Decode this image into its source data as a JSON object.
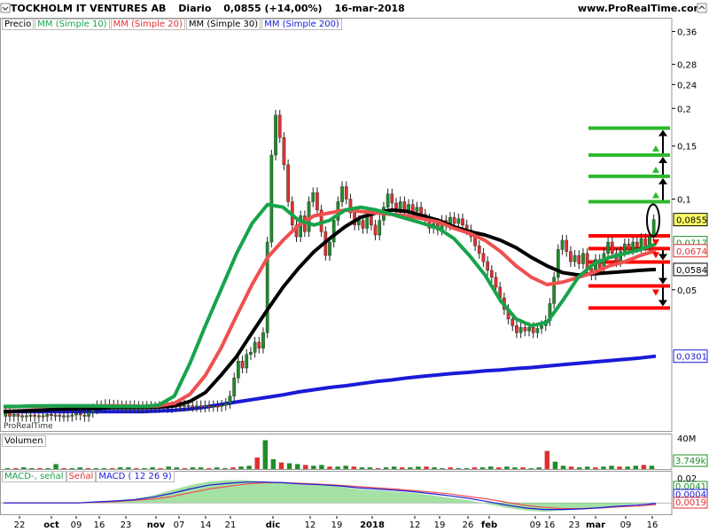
{
  "header": {
    "name": "STOCKHOLM IT VENTURES AB",
    "period": "Diario",
    "quote": "0,0855 (+14,00%)",
    "date": "16-mar-2018",
    "site": "www.ProRealTime.com"
  },
  "legend": {
    "price": "Precio",
    "mm10": "MM (Simple 10)",
    "mm20": "MM (Simple 20)",
    "mm30": "MM (Simple 30)",
    "mm200": "MM (Simple 200)"
  },
  "colors": {
    "up": "#1f8c2a",
    "down": "#e03030",
    "mm10": "#17a34a",
    "mm20": "#f05050",
    "mm30": "#000000",
    "mm200": "#1a1ad8",
    "level_green": "#2db82d",
    "level_red": "#ff0000"
  },
  "watermark": "ProRealTime",
  "chart_data": [
    {
      "type": "line",
      "panel": "price",
      "y_scale": "log",
      "ylim": [
        0.017,
        0.4
      ],
      "y_ticks": [
        "0,36",
        "0,28",
        "0,24",
        "0,2",
        "0,15",
        "0,1",
        "0,05"
      ],
      "y_tick_values": [
        0.36,
        0.28,
        0.24,
        0.2,
        0.15,
        0.1,
        0.05
      ],
      "x_labels": [
        "22",
        "oct",
        "09",
        "16",
        "23",
        "nov",
        "07",
        "14",
        "21",
        "dic",
        "12",
        "19",
        "2018",
        "12",
        "19",
        "26",
        "feb",
        "09",
        "16",
        "23",
        "mar",
        "09",
        "16"
      ],
      "price_labels": [
        {
          "text": "0,0855",
          "value": 0.0855,
          "bg": "#ffff66",
          "border": "#000000"
        },
        {
          "text": "0,0717",
          "value": 0.0717,
          "bg": "#ffffff",
          "border": "#1f8c2a",
          "color": "#1f8c2a"
        },
        {
          "text": "0,0674",
          "value": 0.0674,
          "bg": "#ffffff",
          "border": "#e03030",
          "color": "#e03030"
        },
        {
          "text": "0,0584",
          "value": 0.0584,
          "bg": "#ffffff",
          "border": "#000000",
          "color": "#000000"
        },
        {
          "text": "0,0301",
          "value": 0.0301,
          "bg": "#ffffff",
          "border": "#1a1ad8",
          "color": "#1a1ad8"
        }
      ],
      "green_levels": [
        0.172,
        0.14,
        0.119,
        0.098
      ],
      "red_levels": [
        0.0755,
        0.0685,
        0.0618,
        0.0515,
        0.0435
      ],
      "candle_values": [
        [
          0.019,
          0.0195
        ],
        [
          0.0195,
          0.019
        ],
        [
          0.019,
          0.0193
        ],
        [
          0.0193,
          0.019
        ],
        [
          0.019,
          0.0191
        ],
        [
          0.0191,
          0.019
        ],
        [
          0.019,
          0.0192
        ],
        [
          0.0192,
          0.019
        ],
        [
          0.019,
          0.0191
        ],
        [
          0.0191,
          0.019
        ],
        [
          0.019,
          0.0193
        ],
        [
          0.0193,
          0.0191
        ],
        [
          0.0191,
          0.0192
        ],
        [
          0.0192,
          0.019
        ],
        [
          0.019,
          0.0191
        ],
        [
          0.0191,
          0.019
        ],
        [
          0.019,
          0.0192
        ],
        [
          0.0192,
          0.0194
        ],
        [
          0.0194,
          0.0192
        ],
        [
          0.0192,
          0.019
        ],
        [
          0.019,
          0.0196
        ],
        [
          0.0196,
          0.0201
        ],
        [
          0.0201,
          0.0206
        ],
        [
          0.0206,
          0.0203
        ],
        [
          0.0203,
          0.0208
        ],
        [
          0.0208,
          0.0205
        ],
        [
          0.0205,
          0.0207
        ],
        [
          0.0207,
          0.0204
        ],
        [
          0.0204,
          0.0206
        ],
        [
          0.0206,
          0.0203
        ],
        [
          0.0203,
          0.0206
        ],
        [
          0.0206,
          0.0204
        ],
        [
          0.0204,
          0.0205
        ],
        [
          0.0205,
          0.0203
        ],
        [
          0.0203,
          0.0205
        ],
        [
          0.0205,
          0.0204
        ],
        [
          0.0204,
          0.0203
        ],
        [
          0.0203,
          0.0205
        ],
        [
          0.0205,
          0.0204
        ],
        [
          0.0204,
          0.0203
        ],
        [
          0.0203,
          0.0205
        ],
        [
          0.0205,
          0.0206
        ],
        [
          0.0206,
          0.0205
        ],
        [
          0.0205,
          0.0207
        ],
        [
          0.0207,
          0.0206
        ],
        [
          0.0206,
          0.0205
        ],
        [
          0.0205,
          0.0206
        ],
        [
          0.0206,
          0.0204
        ],
        [
          0.0204,
          0.0206
        ],
        [
          0.0206,
          0.0205
        ],
        [
          0.0205,
          0.0206
        ],
        [
          0.0206,
          0.0205
        ],
        [
          0.0205,
          0.0207
        ],
        [
          0.0207,
          0.021
        ],
        [
          0.021,
          0.0222
        ],
        [
          0.0222,
          0.0255
        ],
        [
          0.0255,
          0.029
        ],
        [
          0.029,
          0.0275
        ],
        [
          0.0275,
          0.0305
        ],
        [
          0.0305,
          0.031
        ],
        [
          0.031,
          0.0335
        ],
        [
          0.0335,
          0.032
        ],
        [
          0.032,
          0.036
        ],
        [
          0.036,
          0.072
        ],
        [
          0.072,
          0.14
        ],
        [
          0.14,
          0.19
        ],
        [
          0.19,
          0.16
        ],
        [
          0.16,
          0.13
        ],
        [
          0.13,
          0.098
        ],
        [
          0.098,
          0.082
        ],
        [
          0.082,
          0.075
        ],
        [
          0.075,
          0.088
        ],
        [
          0.088,
          0.078
        ],
        [
          0.078,
          0.098
        ],
        [
          0.098,
          0.105
        ],
        [
          0.105,
          0.092
        ],
        [
          0.092,
          0.078
        ],
        [
          0.078,
          0.065
        ],
        [
          0.065,
          0.072
        ],
        [
          0.072,
          0.085
        ],
        [
          0.085,
          0.098
        ],
        [
          0.098,
          0.11
        ],
        [
          0.11,
          0.1
        ],
        [
          0.1,
          0.09
        ],
        [
          0.09,
          0.082
        ],
        [
          0.082,
          0.085
        ],
        [
          0.085,
          0.08
        ],
        [
          0.08,
          0.088
        ],
        [
          0.088,
          0.082
        ],
        [
          0.082,
          0.076
        ],
        [
          0.076,
          0.085
        ],
        [
          0.085,
          0.094
        ],
        [
          0.094,
          0.104
        ],
        [
          0.104,
          0.097
        ],
        [
          0.097,
          0.093
        ],
        [
          0.093,
          0.098
        ],
        [
          0.098,
          0.092
        ],
        [
          0.092,
          0.096
        ],
        [
          0.096,
          0.091
        ],
        [
          0.091,
          0.094
        ],
        [
          0.094,
          0.089
        ],
        [
          0.089,
          0.086
        ],
        [
          0.086,
          0.08
        ],
        [
          0.08,
          0.083
        ],
        [
          0.083,
          0.079
        ],
        [
          0.079,
          0.085
        ],
        [
          0.085,
          0.082
        ],
        [
          0.082,
          0.087
        ],
        [
          0.087,
          0.083
        ],
        [
          0.083,
          0.086
        ],
        [
          0.086,
          0.082
        ],
        [
          0.082,
          0.079
        ],
        [
          0.079,
          0.075
        ],
        [
          0.075,
          0.07
        ],
        [
          0.07,
          0.066
        ],
        [
          0.066,
          0.062
        ],
        [
          0.062,
          0.058
        ],
        [
          0.058,
          0.055
        ],
        [
          0.055,
          0.051
        ],
        [
          0.051,
          0.047
        ],
        [
          0.047,
          0.043
        ],
        [
          0.043,
          0.04
        ],
        [
          0.04,
          0.038
        ],
        [
          0.038,
          0.036
        ],
        [
          0.036,
          0.0375
        ],
        [
          0.0375,
          0.0365
        ],
        [
          0.0365,
          0.0375
        ],
        [
          0.0375,
          0.036
        ],
        [
          0.036,
          0.0372
        ],
        [
          0.0372,
          0.038
        ],
        [
          0.038,
          0.0395
        ],
        [
          0.0395,
          0.045
        ],
        [
          0.045,
          0.055
        ],
        [
          0.055,
          0.068
        ],
        [
          0.068,
          0.073
        ],
        [
          0.073,
          0.067
        ],
        [
          0.067,
          0.062
        ],
        [
          0.062,
          0.065
        ],
        [
          0.065,
          0.061
        ],
        [
          0.061,
          0.066
        ],
        [
          0.066,
          0.059
        ],
        [
          0.059,
          0.056
        ],
        [
          0.056,
          0.063
        ],
        [
          0.063,
          0.059
        ],
        [
          0.059,
          0.066
        ],
        [
          0.066,
          0.072
        ],
        [
          0.072,
          0.066
        ],
        [
          0.066,
          0.062
        ],
        [
          0.062,
          0.067
        ],
        [
          0.067,
          0.071
        ],
        [
          0.071,
          0.068
        ],
        [
          0.068,
          0.072
        ],
        [
          0.072,
          0.069
        ],
        [
          0.069,
          0.074
        ],
        [
          0.074,
          0.07
        ],
        [
          0.07,
          0.075
        ],
        [
          0.075,
          0.0855
        ]
      ],
      "series": [
        {
          "name": "MM (Simple 10)",
          "values": [
            0.0205,
            0.0205,
            0.0206,
            0.0206,
            0.0206,
            0.0206,
            0.0206,
            0.0205,
            0.0205,
            0.0205,
            0.0207,
            0.0222,
            0.0285,
            0.038,
            0.05,
            0.066,
            0.083,
            0.096,
            0.094,
            0.085,
            0.082,
            0.085,
            0.092,
            0.094,
            0.092,
            0.089,
            0.086,
            0.083,
            0.08,
            0.074,
            0.065,
            0.056,
            0.046,
            0.04,
            0.038,
            0.039,
            0.046,
            0.055,
            0.061,
            0.064,
            0.066,
            0.068,
            0.071
          ]
        },
        {
          "name": "MM (Simple 20)",
          "values": [
            0.0204,
            0.0205,
            0.0205,
            0.0206,
            0.0206,
            0.0206,
            0.0206,
            0.0206,
            0.0206,
            0.0205,
            0.0206,
            0.021,
            0.0225,
            0.026,
            0.032,
            0.041,
            0.052,
            0.064,
            0.073,
            0.082,
            0.088,
            0.09,
            0.092,
            0.091,
            0.09,
            0.089,
            0.088,
            0.086,
            0.084,
            0.08,
            0.077,
            0.073,
            0.067,
            0.06,
            0.055,
            0.052,
            0.053,
            0.055,
            0.057,
            0.06,
            0.062,
            0.065,
            0.0674
          ]
        },
        {
          "name": "MM (Simple 30)",
          "values": [
            0.0197,
            0.0198,
            0.0199,
            0.02,
            0.0201,
            0.0202,
            0.0202,
            0.0203,
            0.0203,
            0.0203,
            0.0204,
            0.0206,
            0.0213,
            0.0228,
            0.026,
            0.03,
            0.036,
            0.043,
            0.051,
            0.059,
            0.067,
            0.074,
            0.081,
            0.087,
            0.09,
            0.092,
            0.091,
            0.088,
            0.085,
            0.081,
            0.078,
            0.076,
            0.073,
            0.069,
            0.064,
            0.06,
            0.057,
            0.056,
            0.0565,
            0.057,
            0.0575,
            0.058,
            0.0584
          ]
        },
        {
          "name": "MM (Simple 200)",
          "values": [
            0.0197,
            0.0197,
            0.0197,
            0.0197,
            0.0197,
            0.0197,
            0.0197,
            0.0197,
            0.0197,
            0.0197,
            0.0198,
            0.0199,
            0.0201,
            0.0204,
            0.0208,
            0.0212,
            0.0216,
            0.022,
            0.0224,
            0.0229,
            0.0233,
            0.0237,
            0.024,
            0.0244,
            0.0248,
            0.0251,
            0.0255,
            0.0258,
            0.0261,
            0.0264,
            0.0266,
            0.0269,
            0.0271,
            0.0274,
            0.0276,
            0.0279,
            0.0282,
            0.0285,
            0.0288,
            0.0291,
            0.0294,
            0.0297,
            0.0301
          ]
        }
      ]
    },
    {
      "type": "bar",
      "panel": "volume",
      "title": "Volumen",
      "y_ticks": [
        "40M"
      ],
      "last_label": "3.749k",
      "ylim": [
        0,
        42
      ],
      "values": [
        1,
        1,
        2,
        1,
        1,
        1,
        6,
        1,
        1,
        2,
        1,
        1,
        1,
        1,
        2,
        2,
        1,
        1,
        2,
        1,
        3,
        2,
        1,
        2,
        2,
        1,
        2,
        1,
        2,
        3,
        4,
        14,
        35,
        12,
        8,
        7,
        6,
        5,
        4,
        5,
        3,
        3,
        4,
        3,
        2,
        2,
        1,
        2,
        3,
        2,
        2,
        3,
        3,
        2,
        1,
        2,
        1,
        1,
        2,
        2,
        3,
        2,
        3,
        2,
        2,
        1,
        2,
        22,
        9,
        4,
        3,
        2,
        3,
        2,
        3,
        4,
        3,
        3,
        4,
        5,
        4
      ]
    },
    {
      "type": "line",
      "panel": "macd",
      "series": [
        {
          "name": "MACD-, señal",
          "values": [
            0,
            0,
            0,
            0,
            0,
            0.001,
            0.002,
            0.003,
            0.006,
            0.01,
            0.014,
            0.017,
            0.018,
            0.018,
            0.017,
            0.016,
            0.015,
            0.014,
            0.013,
            0.011,
            0.01,
            0.009,
            0.008,
            0.006,
            0.004,
            0.002,
            -0.001,
            -0.004,
            -0.006,
            -0.007,
            -0.006,
            -0.005,
            -0.004,
            -0.002,
            -0.001,
            0.0005
          ]
        },
        {
          "name": "Señal",
          "values": [
            0,
            0,
            0,
            0,
            0,
            0.0005,
            0.001,
            0.002,
            0.003,
            0.005,
            0.008,
            0.011,
            0.013,
            0.015,
            0.016,
            0.016,
            0.0155,
            0.0148,
            0.014,
            0.013,
            0.012,
            0.011,
            0.0098,
            0.0085,
            0.007,
            0.005,
            0.003,
            0.0005,
            -0.002,
            -0.0035,
            -0.0045,
            -0.0045,
            -0.004,
            -0.0032,
            -0.0025,
            -0.0015
          ]
        },
        {
          "name": "MACD ( 12 26 9)",
          "values": [
            0,
            0,
            0,
            0,
            0,
            0.0008,
            0.0015,
            0.0025,
            0.0045,
            0.0075,
            0.011,
            0.014,
            0.0155,
            0.0165,
            0.0165,
            0.016,
            0.015,
            0.0144,
            0.0135,
            0.012,
            0.011,
            0.01,
            0.0089,
            0.0072,
            0.0055,
            0.0035,
            0.001,
            -0.0018,
            -0.004,
            -0.0052,
            -0.0052,
            -0.0048,
            -0.0038,
            -0.0026,
            -0.0018,
            -0.0005
          ]
        }
      ],
      "y_ticks": [
        "0,02",
        "0,0041",
        "0,0004",
        "0,0019"
      ],
      "ylim": [
        -0.009,
        0.024
      ]
    }
  ]
}
